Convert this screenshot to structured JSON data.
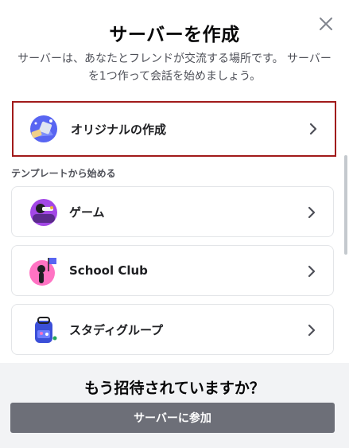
{
  "dialog": {
    "title": "サーバーを作成",
    "subtitle": "サーバーは、あなたとフレンドが交流する場所です。 サーバーを1つ作って会話を始めましょう。"
  },
  "create_own": {
    "label": "オリジナルの作成",
    "icon": "create-server-icon"
  },
  "templates": {
    "section_label": "テンプレートから始める",
    "items": [
      {
        "label": "ゲーム",
        "icon": "gaming-template-icon"
      },
      {
        "label": "School Club",
        "icon": "school-club-template-icon"
      },
      {
        "label": "スタディグループ",
        "icon": "study-group-template-icon"
      }
    ]
  },
  "footer": {
    "title": "もう招待されていますか？",
    "join_label": "サーバーに参加"
  },
  "colors": {
    "highlight_border": "#a11a1a",
    "join_button": "#6d6f78",
    "footer_bg": "#f2f3f5"
  }
}
